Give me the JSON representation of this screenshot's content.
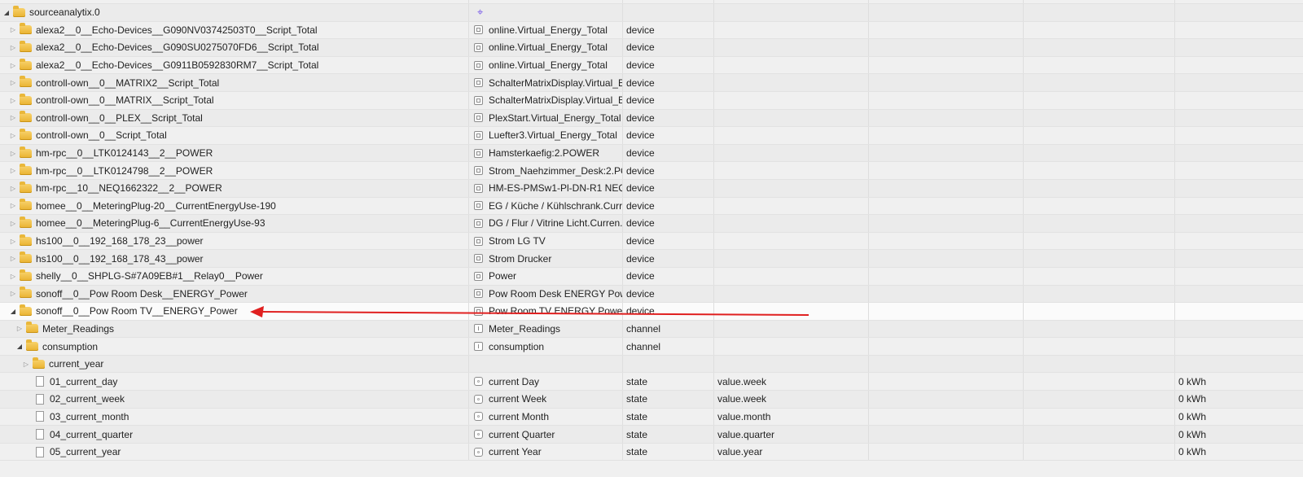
{
  "root": {
    "name": "sourceanalytix.0",
    "icon": "crosshair-icon"
  },
  "rows": [
    {
      "depth": 1,
      "toggle": "closed",
      "icon": "folder",
      "name": "alexa2__0__Echo-Devices__G090NV03742503T0__Script_Total",
      "icon_type": "device",
      "display": "online.Virtual_Energy_Total",
      "type": "device",
      "role": "",
      "value": ""
    },
    {
      "depth": 1,
      "toggle": "closed",
      "icon": "folder",
      "name": "alexa2__0__Echo-Devices__G090SU0275070FD6__Script_Total",
      "icon_type": "device",
      "display": "online.Virtual_Energy_Total",
      "type": "device",
      "role": "",
      "value": ""
    },
    {
      "depth": 1,
      "toggle": "closed",
      "icon": "folder",
      "name": "alexa2__0__Echo-Devices__G0911B0592830RM7__Script_Total",
      "icon_type": "device",
      "display": "online.Virtual_Energy_Total",
      "type": "device",
      "role": "",
      "value": ""
    },
    {
      "depth": 1,
      "toggle": "closed",
      "icon": "folder",
      "name": "controll-own__0__MATRIX2__Script_Total",
      "icon_type": "device",
      "display": "SchalterMatrixDisplay.Virtual_E...",
      "type": "device",
      "role": "",
      "value": ""
    },
    {
      "depth": 1,
      "toggle": "closed",
      "icon": "folder",
      "name": "controll-own__0__MATRIX__Script_Total",
      "icon_type": "device",
      "display": "SchalterMatrixDisplay.Virtual_E...",
      "type": "device",
      "role": "",
      "value": ""
    },
    {
      "depth": 1,
      "toggle": "closed",
      "icon": "folder",
      "name": "controll-own__0__PLEX__Script_Total",
      "icon_type": "device",
      "display": "PlexStart.Virtual_Energy_Total",
      "type": "device",
      "role": "",
      "value": ""
    },
    {
      "depth": 1,
      "toggle": "closed",
      "icon": "folder",
      "name": "controll-own__0__Script_Total",
      "icon_type": "device",
      "display": "Luefter3.Virtual_Energy_Total",
      "type": "device",
      "role": "",
      "value": ""
    },
    {
      "depth": 1,
      "toggle": "closed",
      "icon": "folder",
      "name": "hm-rpc__0__LTK0124143__2__POWER",
      "icon_type": "device",
      "display": "Hamsterkaefig:2.POWER",
      "type": "device",
      "role": "",
      "value": ""
    },
    {
      "depth": 1,
      "toggle": "closed",
      "icon": "folder",
      "name": "hm-rpc__0__LTK0124798__2__POWER",
      "icon_type": "device",
      "display": "Strom_Naehzimmer_Desk:2.PO...",
      "type": "device",
      "role": "",
      "value": ""
    },
    {
      "depth": 1,
      "toggle": "closed",
      "icon": "folder",
      "name": "hm-rpc__10__NEQ1662322__2__POWER",
      "icon_type": "device",
      "display": "HM-ES-PMSw1-Pl-DN-R1 NEQ...",
      "type": "device",
      "role": "",
      "value": ""
    },
    {
      "depth": 1,
      "toggle": "closed",
      "icon": "folder",
      "name": "homee__0__MeteringPlug-20__CurrentEnergyUse-190",
      "icon_type": "device",
      "display": "EG / Küche / Kühlschrank.Curr...",
      "type": "device",
      "role": "",
      "value": ""
    },
    {
      "depth": 1,
      "toggle": "closed",
      "icon": "folder",
      "name": "homee__0__MeteringPlug-6__CurrentEnergyUse-93",
      "icon_type": "device",
      "display": "DG / Flur / Vitrine Licht.Curren...",
      "type": "device",
      "role": "",
      "value": ""
    },
    {
      "depth": 1,
      "toggle": "closed",
      "icon": "folder",
      "name": "hs100__0__192_168_178_23__power",
      "icon_type": "device",
      "display": "Strom LG TV",
      "type": "device",
      "role": "",
      "value": ""
    },
    {
      "depth": 1,
      "toggle": "closed",
      "icon": "folder",
      "name": "hs100__0__192_168_178_43__power",
      "icon_type": "device",
      "display": "Strom Drucker",
      "type": "device",
      "role": "",
      "value": ""
    },
    {
      "depth": 1,
      "toggle": "closed",
      "icon": "folder",
      "name": "shelly__0__SHPLG-S#7A09EB#1__Relay0__Power",
      "icon_type": "device",
      "display": "Power",
      "type": "device",
      "role": "",
      "value": ""
    },
    {
      "depth": 1,
      "toggle": "closed",
      "icon": "folder",
      "name": "sonoff__0__Pow Room Desk__ENERGY_Power",
      "icon_type": "device",
      "display": "Pow Room Desk ENERGY Power",
      "type": "device",
      "role": "",
      "value": ""
    },
    {
      "depth": 1,
      "toggle": "open",
      "icon": "folder",
      "name": "sonoff__0__Pow Room TV__ENERGY_Power",
      "icon_type": "device",
      "display": "Pow Room TV ENERGY Power",
      "type": "device",
      "role": "",
      "value": "",
      "highlight": true
    },
    {
      "depth": 2,
      "toggle": "closed",
      "icon": "folder",
      "name": "Meter_Readings",
      "icon_type": "channel",
      "display": "Meter_Readings",
      "type": "channel",
      "role": "",
      "value": ""
    },
    {
      "depth": 2,
      "toggle": "open",
      "icon": "folder",
      "name": "consumption",
      "icon_type": "channel",
      "display": "consumption",
      "type": "channel",
      "role": "",
      "value": ""
    },
    {
      "depth": 3,
      "toggle": "closed",
      "icon": "folder",
      "name": "current_year",
      "icon_type": "",
      "display": "",
      "type": "",
      "role": "",
      "value": ""
    },
    {
      "depth": 3,
      "toggle": "none",
      "icon": "file",
      "name": "01_current_day",
      "icon_type": "state",
      "display": "current Day",
      "type": "state",
      "role": "value.week",
      "value": "0 kWh"
    },
    {
      "depth": 3,
      "toggle": "none",
      "icon": "file",
      "name": "02_current_week",
      "icon_type": "state",
      "display": "current Week",
      "type": "state",
      "role": "value.week",
      "value": "0 kWh"
    },
    {
      "depth": 3,
      "toggle": "none",
      "icon": "file",
      "name": "03_current_month",
      "icon_type": "state",
      "display": "current Month",
      "type": "state",
      "role": "value.month",
      "value": "0 kWh"
    },
    {
      "depth": 3,
      "toggle": "none",
      "icon": "file",
      "name": "04_current_quarter",
      "icon_type": "state",
      "display": "current Quarter",
      "type": "state",
      "role": "value.quarter",
      "value": "0 kWh"
    },
    {
      "depth": 3,
      "toggle": "none",
      "icon": "file",
      "name": "05_current_year",
      "icon_type": "state",
      "display": "current Year",
      "type": "state",
      "role": "value.year",
      "value": "0 kWh"
    }
  ],
  "annotation": {
    "color": "#e02020",
    "description_target": "sonoff__0__Pow Room TV__ENERGY_Power"
  }
}
